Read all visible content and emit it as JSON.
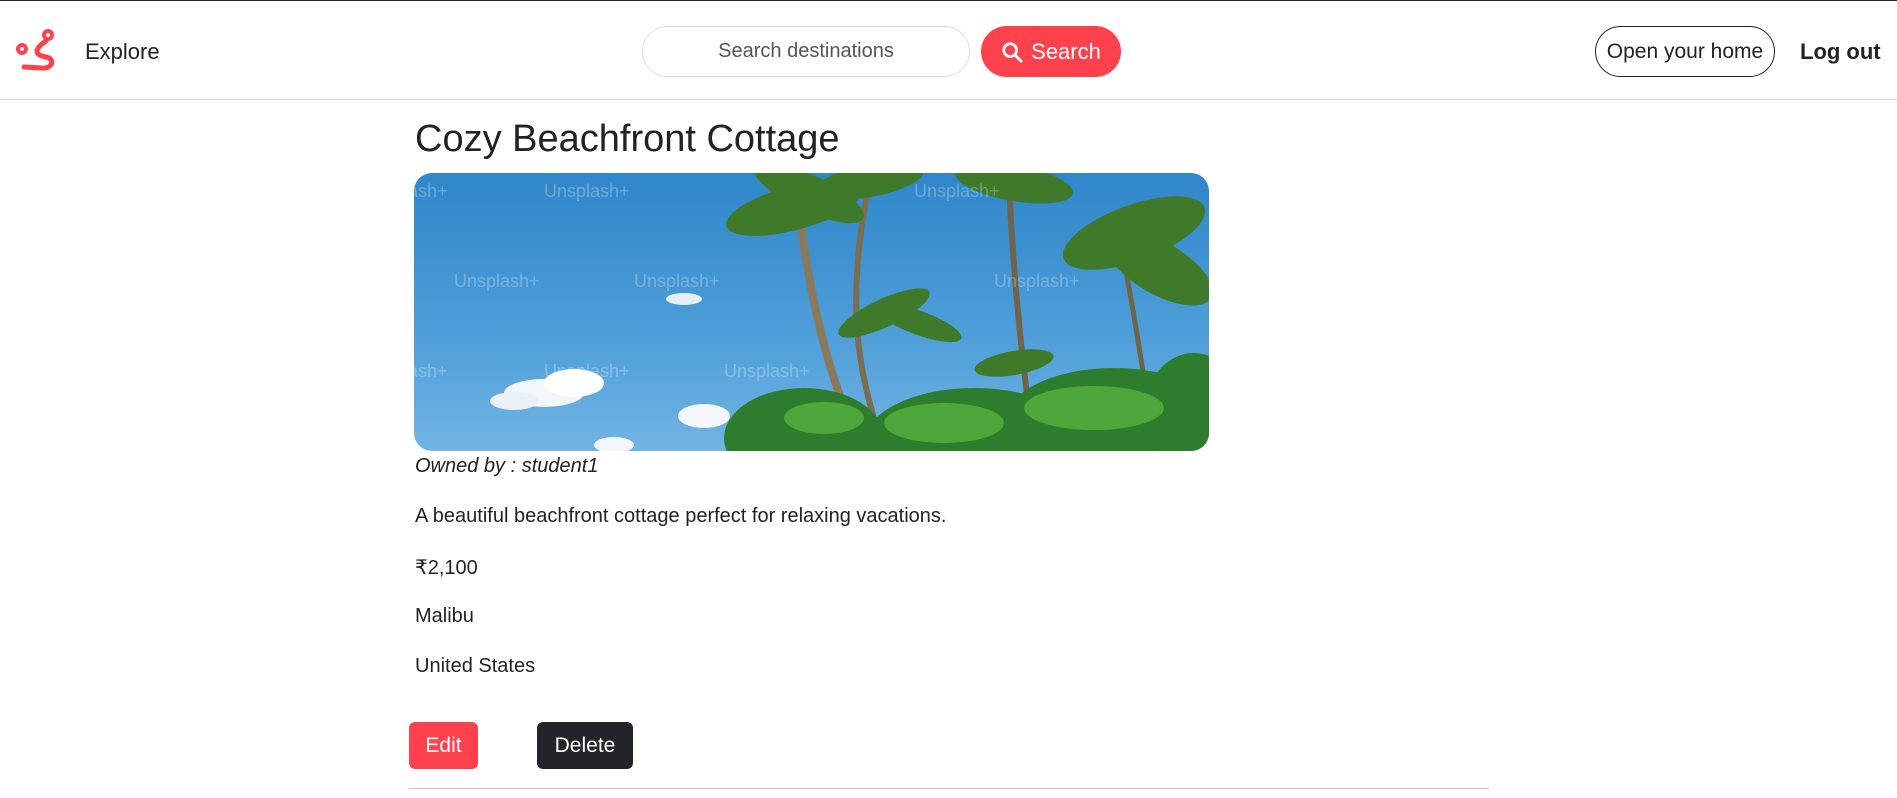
{
  "navbar": {
    "explore_label": "Explore",
    "search_placeholder": "Search destinations",
    "search_button_label": "Search",
    "open_home_label": "Open your home",
    "logout_label": "Log out",
    "brand_color": "#fe424d"
  },
  "listing": {
    "title": "Cozy Beachfront Cottage",
    "image_watermark": "Unsplash+",
    "owner_text": "Owned by : student1",
    "description": "A beautiful beachfront cottage perfect for relaxing vacations.",
    "price": "₹2,100",
    "location": "Malibu",
    "country": "United States",
    "edit_label": "Edit",
    "delete_label": "Delete"
  }
}
